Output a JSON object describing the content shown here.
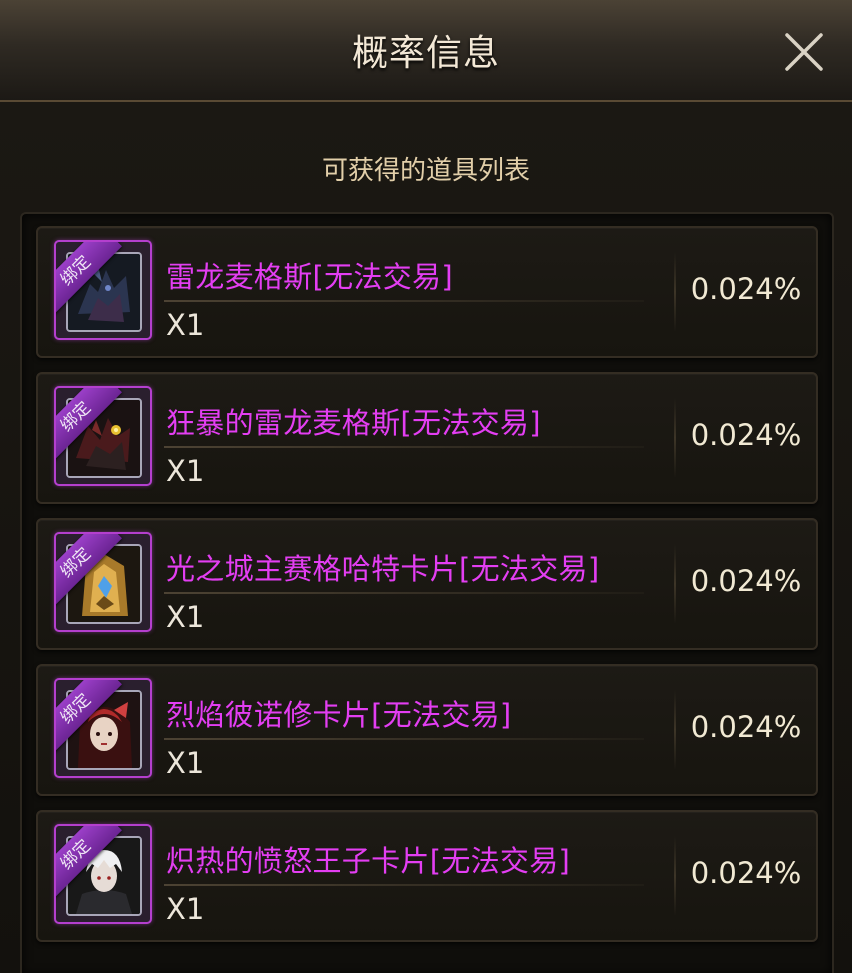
{
  "header": {
    "title": "概率信息",
    "close_icon": "close-icon"
  },
  "subtitle": "可获得的道具列表",
  "items": [
    {
      "bind_label": "绑定",
      "name": "雷龙麦格斯[无法交易]",
      "quantity": "X1",
      "probability": "0.024%",
      "art": "dark-dragon"
    },
    {
      "bind_label": "绑定",
      "name": "狂暴的雷龙麦格斯[无法交易]",
      "quantity": "X1",
      "probability": "0.024%",
      "art": "berserk-dragon"
    },
    {
      "bind_label": "绑定",
      "name": "光之城主赛格哈特卡片[无法交易]",
      "quantity": "X1",
      "probability": "0.024%",
      "art": "golden-armor"
    },
    {
      "bind_label": "绑定",
      "name": "烈焰彼诺修卡片[无法交易]",
      "quantity": "X1",
      "probability": "0.024%",
      "art": "red-haired-woman"
    },
    {
      "bind_label": "绑定",
      "name": "炽热的愤怒王子卡片[无法交易]",
      "quantity": "X1",
      "probability": "0.024%",
      "art": "white-haired-prince"
    }
  ],
  "colors": {
    "item_name": "#e33ef2",
    "bind_ribbon": "#9b3fc8",
    "icon_border": "#b43fce",
    "title_text": "#f3e8d6",
    "subtitle_text": "#e2cfa9"
  }
}
